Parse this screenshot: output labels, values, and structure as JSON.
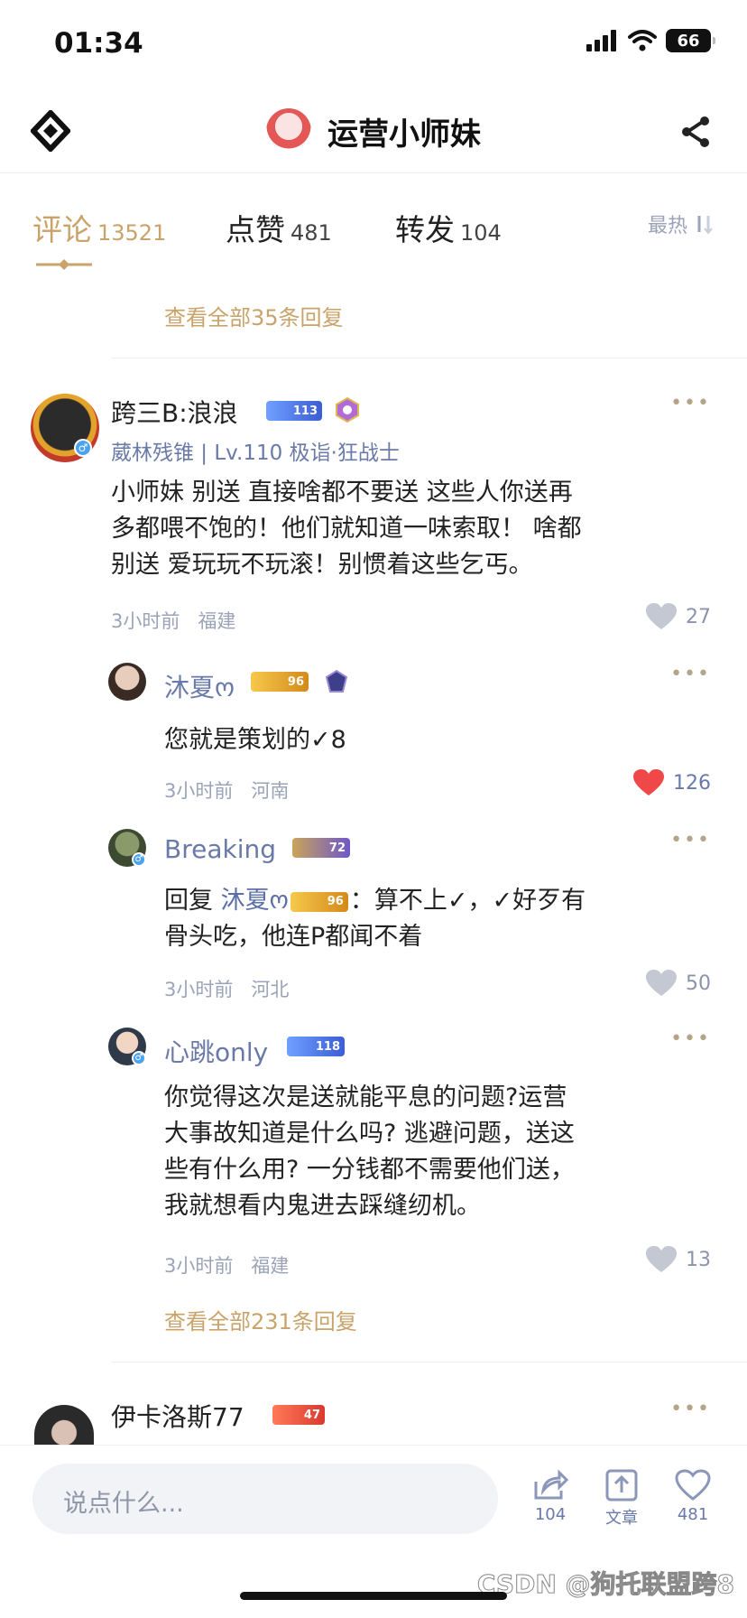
{
  "status": {
    "time": "01:34",
    "battery": "66"
  },
  "header": {
    "title": "运营小师妹"
  },
  "tabs": [
    {
      "label": "评论",
      "count": "13521"
    },
    {
      "label": "点赞",
      "count": "481"
    },
    {
      "label": "转发",
      "count": "104"
    }
  ],
  "sort_label": "最热",
  "view_all_top": "查看全部35条回复",
  "comment": {
    "username": "跨三B:浪浪",
    "level_badge": "113",
    "userinfo": "葳林残锥 | Lv.110 极诣·狂战士",
    "text_lines": [
      "小师妹 别送 直接啥都不要送 这些人你送再",
      "多都喂不饱的！他们就知道一味索取！ 啥都",
      "别送 爱玩玩不玩滚！别惯着这些乞丐。"
    ],
    "time": "3小时前",
    "location": "福建",
    "likes": "27"
  },
  "replies": [
    {
      "username": "沐夏ო",
      "level_badge": "96",
      "text_lines": [
        "您就是策划的✓8"
      ],
      "time": "3小时前",
      "location": "河南",
      "likes": "126"
    },
    {
      "username": "Breaking",
      "level_badge": "72",
      "reply_prefix": "回复 ",
      "mention": "沐夏ო",
      "mention_badge": "96",
      "text_after": "：算不上✓，✓好歹有",
      "text_line2": "骨头吃，他连P都闻不着",
      "time": "3小时前",
      "location": "河北",
      "likes": "50"
    },
    {
      "username": "心跳only",
      "level_badge": "118",
      "text_lines": [
        "你觉得这次是送就能平息的问题?运营",
        "大事故知道是什么吗? 逃避问题，送这",
        "些有什么用? 一分钱都不需要他们送，",
        "我就想看内鬼进去踩缝纫机。"
      ],
      "time": "3小时前",
      "location": "福建",
      "likes": "13"
    }
  ],
  "view_all_bottom": "查看全部231条回复",
  "next_comment": {
    "username": "伊卡洛斯77",
    "level_badge": "47"
  },
  "more_label": "•••",
  "bottom": {
    "placeholder": "说点什么...",
    "share_count": "104",
    "article_label": "文章",
    "like_count": "481",
    "watermark": "CSDN @狗托联盟跨8"
  },
  "colors": {
    "accent": "#c9a36a",
    "link": "#6a7aa8",
    "like_active": "#f04848"
  }
}
